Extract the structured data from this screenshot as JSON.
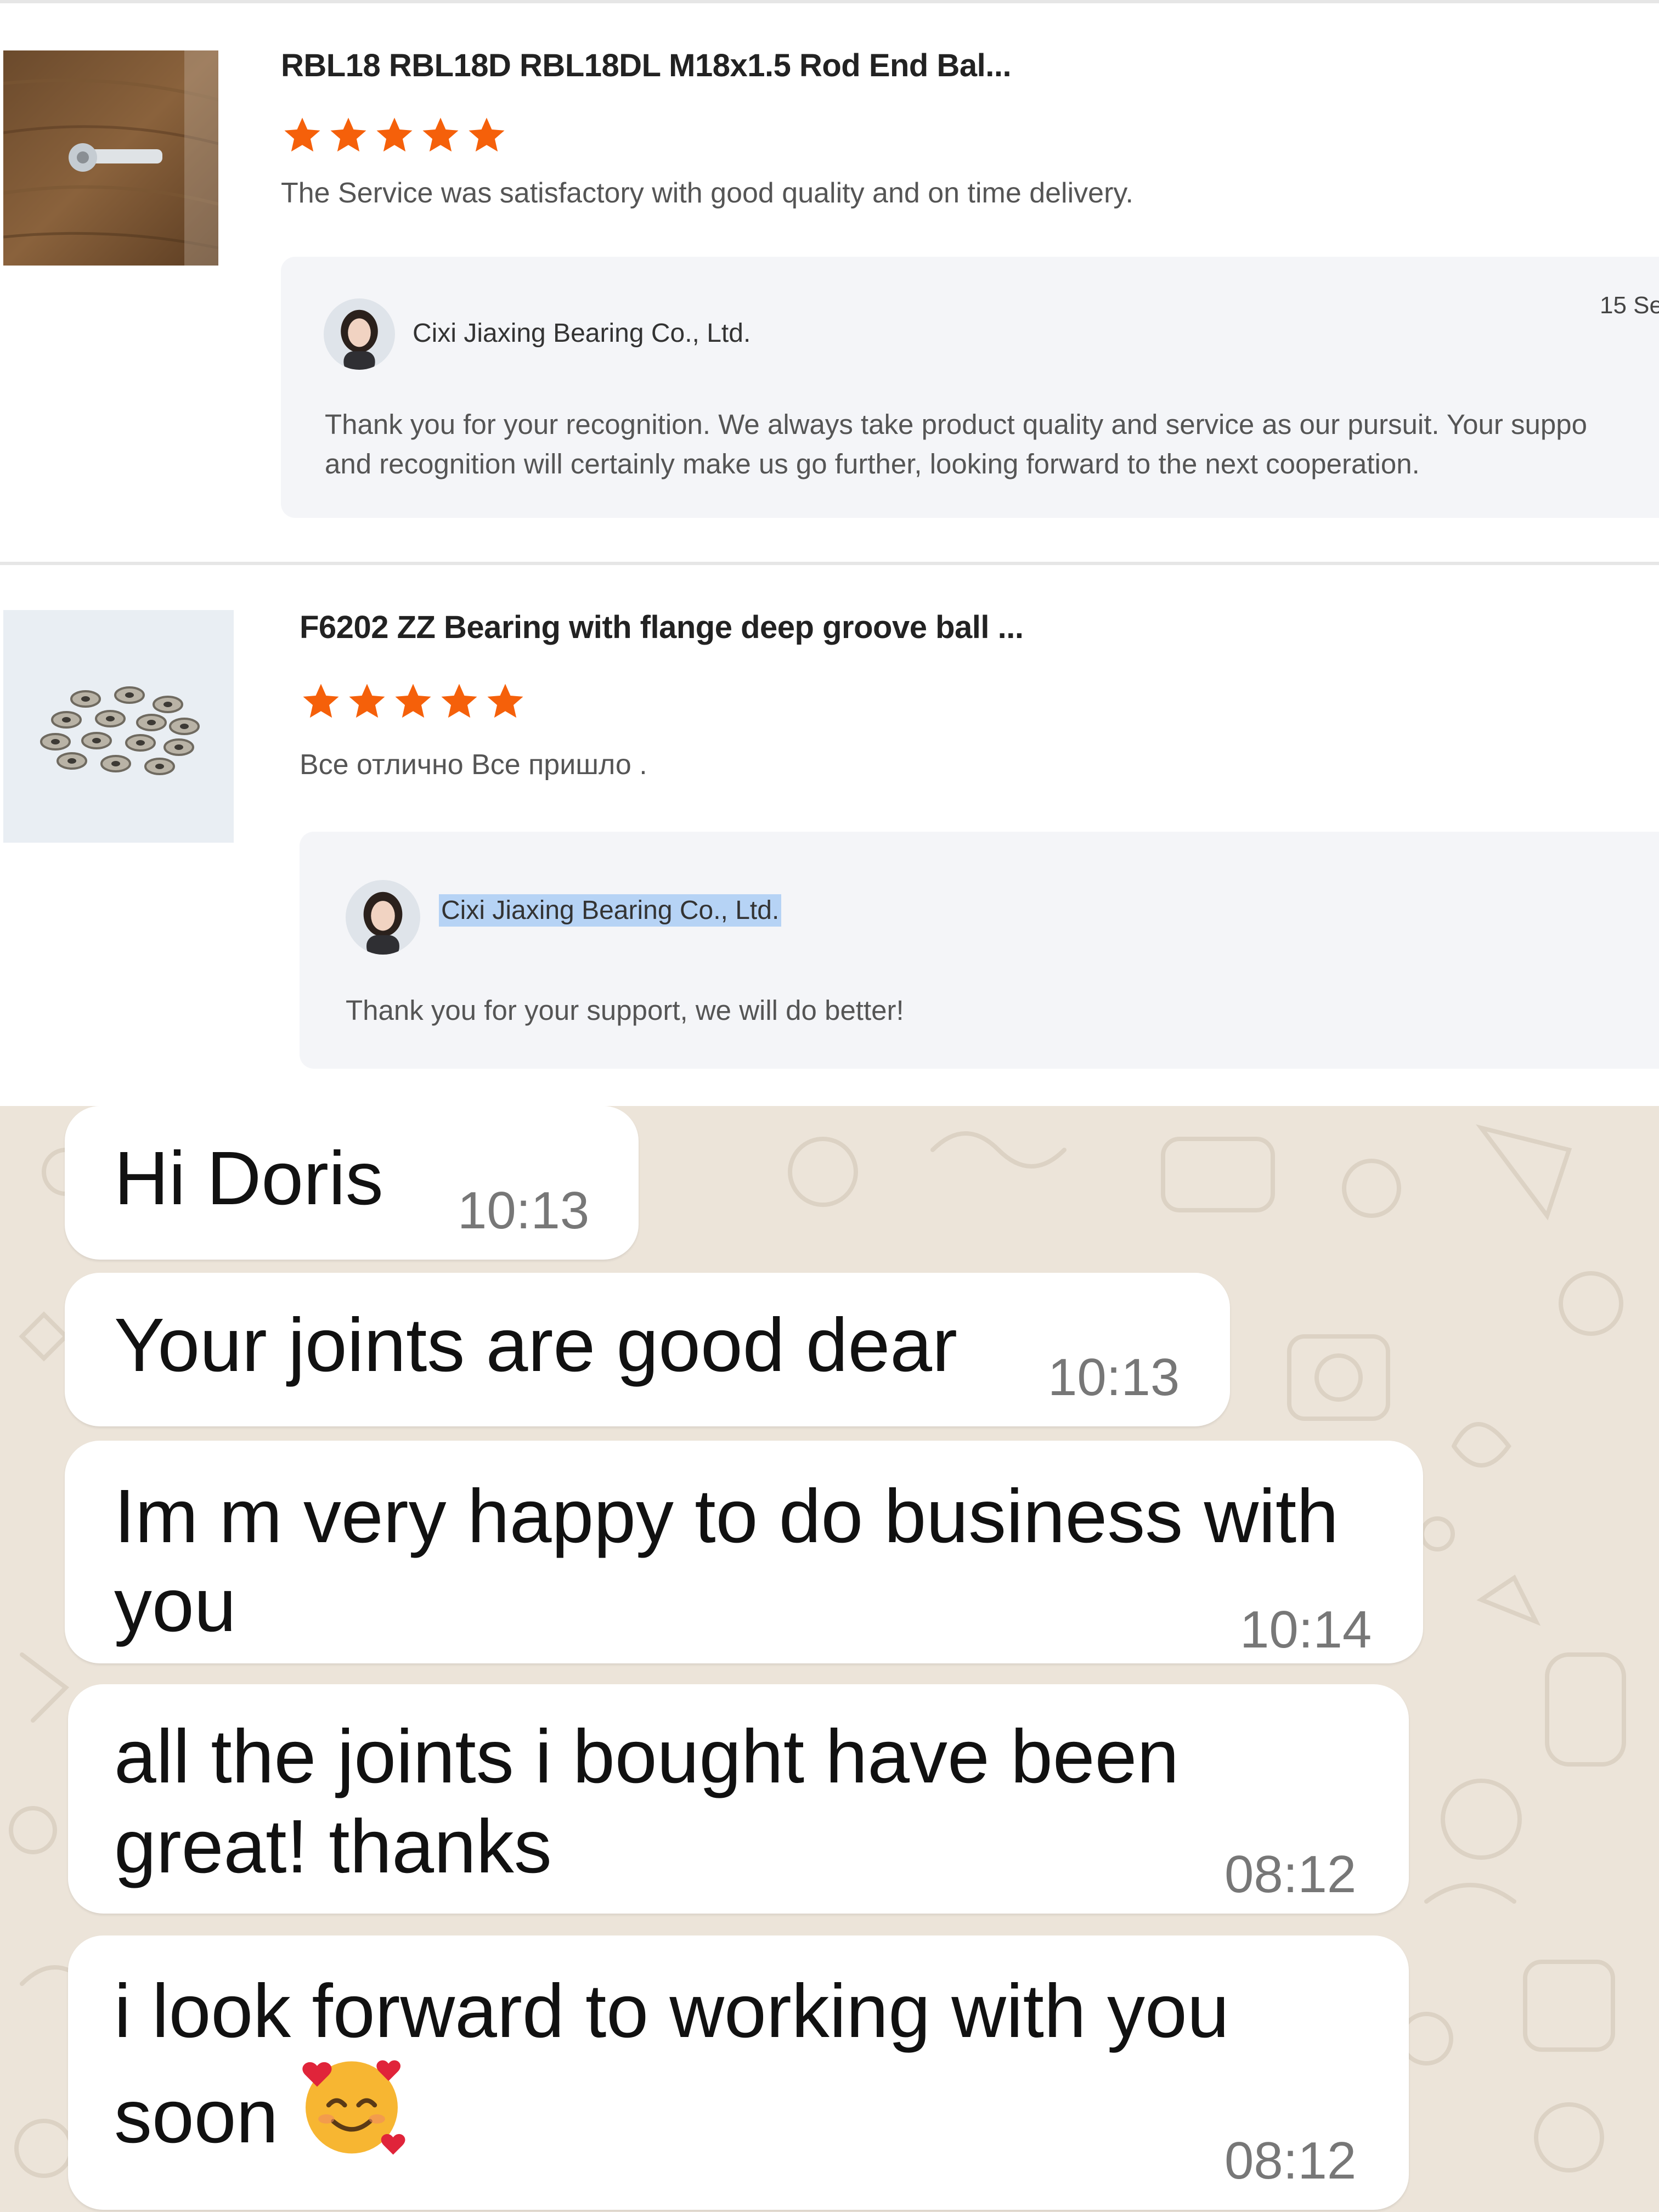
{
  "reviews": [
    {
      "product_title": "RBL18 RBL18D RBL18DL M18x1.5 Rod End Bal...",
      "rating": 5,
      "text": "The Service was satisfactory with good quality and on time delivery.",
      "reply": {
        "seller": "Cixi Jiaxing Bearing Co., Ltd.",
        "date": "15 Se",
        "line1": "Thank you for your recognition. We always take product quality and service as our pursuit. Your suppo",
        "line2": "and recognition will certainly make us go further, looking forward to the next cooperation."
      }
    },
    {
      "product_title": "F6202 ZZ Bearing with flange deep groove ball ...",
      "rating": 5,
      "text": "Все отлично Все пришло .",
      "reply": {
        "seller": "Cixi Jiaxing Bearing Co., Ltd.",
        "line1": "Thank you for your support, we will do better!"
      }
    }
  ],
  "chat": {
    "messages": [
      {
        "lines": [
          "Hi Doris"
        ],
        "time": "10:13"
      },
      {
        "lines": [
          "Your joints are good dear"
        ],
        "time": "10:13"
      },
      {
        "lines": [
          "Im m very happy to do business with",
          "you"
        ],
        "time": "10:14"
      },
      {
        "lines": [
          "all the joints i bought have been",
          "great! thanks"
        ],
        "time": "08:12"
      },
      {
        "lines": [
          "i look forward to working with you",
          "soon"
        ],
        "time": "08:12",
        "emoji": "smiling-face-with-hearts"
      }
    ]
  },
  "colors": {
    "star": "#f5600a",
    "reply_bg": "#f4f5f8",
    "selection": "#b6d3f5",
    "chat_wallpaper": "#ece4d9",
    "bubble": "#ffffff"
  }
}
